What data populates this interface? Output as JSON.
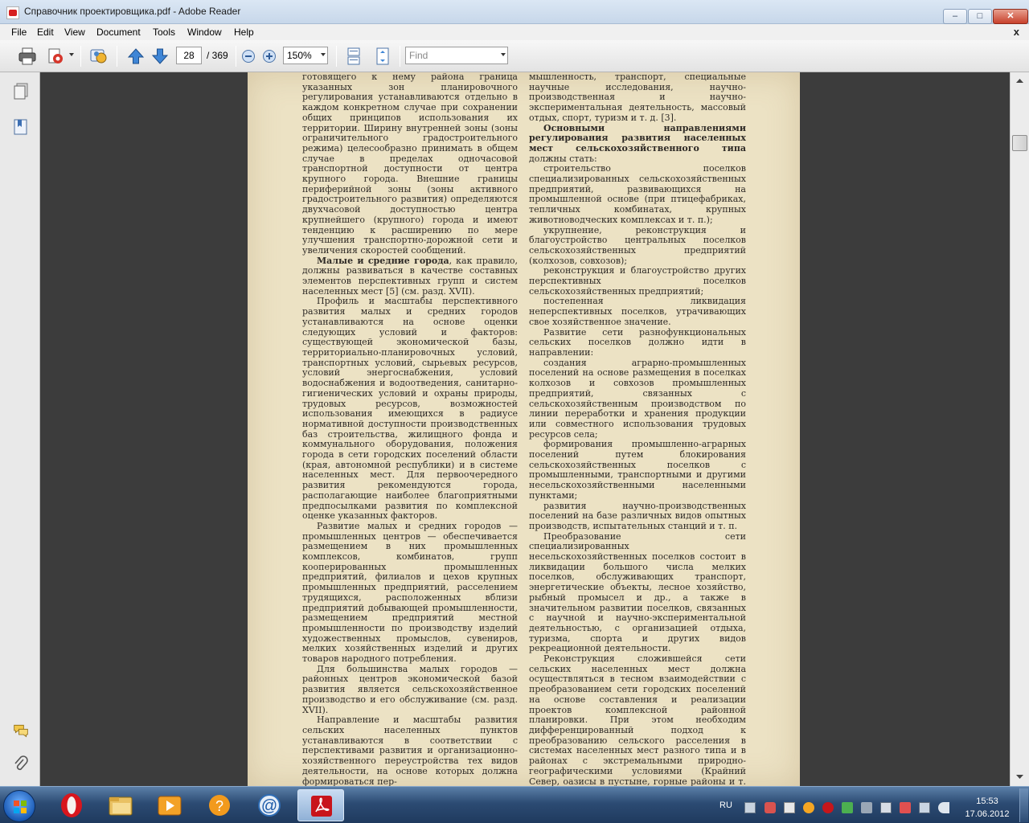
{
  "window": {
    "title": "Справочник проектировщика.pdf - Adobe Reader",
    "minimize": "–",
    "maximize": "□",
    "close": "✕"
  },
  "menubar": {
    "items": [
      "File",
      "Edit",
      "View",
      "Document",
      "Tools",
      "Window",
      "Help"
    ],
    "doc_close": "x"
  },
  "toolbar": {
    "page_number": "28",
    "page_total": "/ 369",
    "zoom": "150%",
    "find_placeholder": "Find",
    "icons": [
      "print-icon",
      "collaborate-icon",
      "share-icon",
      "previous-page-icon",
      "next-page-icon",
      "zoom-out-icon",
      "zoom-in-icon",
      "scrolling-mode-icon",
      "fit-page-icon"
    ]
  },
  "navpane": {
    "icons": [
      "pages-icon",
      "bookmarks-icon",
      "comments-icon",
      "attachments-icon"
    ]
  },
  "document": {
    "left_column": [
      {
        "cont": true,
        "text": "готовящего к нему района граница указанных зон планировочного регулирования устанавливаются отдельно в каждом конкретном случае при сохранении общих принципов использования их территории. Ширину внутренней зоны (зоны ограничительного градостроительного режима) целесообразно принимать в общем случае в пределах одночасовой транспортной доступности от центра крупного города. Внешние границы периферийной зоны (зоны активного градостроительного развития) определяются двухчасовой доступностью центра крупнейшего (крупного) города и имеют тенденцию к расширению по мере улучшения транспортно-дорожной сети и увеличения скоростей сообщений."
      },
      {
        "bold": "Малые и средние города",
        "text": ", как правило, должны развиваться в качестве составных элементов перспективных групп и систем населенных мест [5] (см. разд. XVII)."
      },
      {
        "text": "Профиль и масштабы перспективного развития малых и средних городов устанавливаются на основе оценки следующих условий и факторов: существующей экономической базы, территориально-планировочных условий, транспортных условий, сырьевых ресурсов, условий энергоснабжения, условий водоснабжения и водоотведения, санитарно-гигиенических условий и охраны природы, трудовых ресурсов, возможностей использования имеющихся в радиусе нормативной доступности производственных баз строительства, жилищного фонда и коммунального оборудования, положения города в сети городских поселений области (края, автономной республики) и в системе населенных мест. Для первоочередного развития рекомендуются города, располагающие наиболее благоприятными предпосылками развития по комплексной оценке указанных факторов."
      },
      {
        "text": "Развитие малых и средних городов — промышленных центров — обеспечивается размещением в них промышленных комплексов, комбинатов, групп кооперированных промышленных предприятий, филиалов и цехов крупных промышленных предприятий, расселением трудящихся, расположенных вблизи предприятий добывающей промышленности, размещением предприятий местной промышленности по производству изделий художественных промыслов, сувениров, мелких хозяйственных изделий и других товаров народного потребления."
      },
      {
        "text": "Для большинства малых городов — районных центров экономической базой развития является сельскохозяйственное производство и его обслуживание (см. разд. XVII)."
      },
      {
        "text": "Направление и масштабы развития сельских населенных пунктов устанавливаются в соответствии с перспективами развития и организационно-хозяйственного переустройства тех видов деятельности, на основе которых должна формироваться пер-"
      }
    ],
    "right_column": [
      {
        "cont": true,
        "text": "мышленность, транспорт, специальные научные исследования, научно-производственная и научно-экспериментальная деятельность, массовый отдых, спорт, туризм и т. д. [3]."
      },
      {
        "bold": "Основными направлениями регулирования развития населенных мест сельскохозяйственного типа",
        "text": " должны стать:"
      },
      {
        "text": "строительство поселков специализированных сельскохозяйственных предприятий, развивающихся на промышленной основе (при птицефабриках, тепличных комбинатах, крупных животноводческих комплексах и т. п.);"
      },
      {
        "text": "укрупнение, реконструкция и благоустройство центральных поселков сельскохозяйственных предприятий (колхозов, совхозов);"
      },
      {
        "text": "реконструкция и благоустройство других перспективных поселков сельскохозяйственных предприятий;"
      },
      {
        "text": "постепенная ликвидация неперспективных поселков, утрачивающих свое хозяйственное значение."
      },
      {
        "text": "Развитие сети разнофункциональных сельских поселков должно идти в направлении:"
      },
      {
        "text": "создания аграрно-промышленных поселений на основе размещения в поселках колхозов и совхозов промышленных предприятий, связанных с сельскохозяйственным производством по линии переработки и хранения продукции или совместного использования трудовых ресурсов села;"
      },
      {
        "text": "формирования промышленно-аграрных поселений путем блокирования сельскохозяйственных поселков с промышленными, транспортными и другими несельскохозяйственными населенными пунктами;"
      },
      {
        "text": "развития научно-производственных поселений на базе различных видов опытных производств, испытательных станций и т. п."
      },
      {
        "text": "Преобразование сети специализированных несельскохозяйственных поселков состоит в ликвидации большого числа мелких поселков, обслуживающих транспорт, энергетические объекты, лесное хозяйство, рыбный промысел и др., а также в значительном развитии поселков, связанных с научной и научно-экспериментальной деятельностью, с организацией отдыха, туризма, спорта и других видов рекреационной деятельности."
      },
      {
        "text": "Реконструкция сложившейся сети сельских населенных мест должна осуществляться в тесном взаимодействии с преобразованием сети городских поселений на основе составления и реализации проектов комплексной районной планировки. При этом необходим дифференцированный подход к преобразованию сельского расселения в системах населенных мест разного типа и в районах с экстремальными природно-географическими условиями (Крайний Север, оазисы в пустыне, горные районы и т. д.)."
      }
    ]
  },
  "taskbar": {
    "apps": [
      "start-orb",
      "opera-icon",
      "file-explorer-icon",
      "media-player-icon",
      "updater-icon",
      "email-icon",
      "adobe-reader-icon"
    ],
    "lang": "RU",
    "time": "15:53",
    "date": "17.06.2012"
  },
  "colors": {
    "page_background": "#ece2c4",
    "document_background": "#3c3c3c",
    "reader_red": "#d61f1f",
    "taskbar_blue": "#2c4b73"
  }
}
